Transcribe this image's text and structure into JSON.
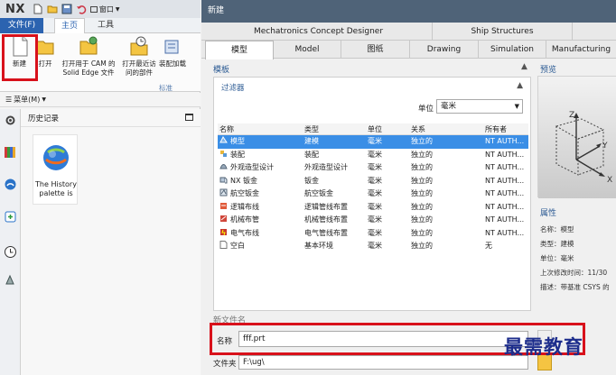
{
  "nx": {
    "logo": "NX",
    "tabs": {
      "file": "文件(F)",
      "home": "主页",
      "tools": "工具"
    },
    "ribbon": {
      "new": "新建",
      "open": "打开",
      "open_cam_1": "打开用于 CAM 的",
      "open_cam_2": "Solid Edge 文件",
      "open_recent_1": "打开最近访",
      "open_recent_2": "问的部件",
      "assembly": "装配加载",
      "group_label": "标准"
    },
    "quick_access": {
      "window_menu": "窗口"
    },
    "menu_bar": {
      "menu_label": "菜单(M)"
    },
    "history": {
      "title": "历史记录",
      "card_text_1": "The History",
      "card_text_2": "palette is"
    }
  },
  "dialog": {
    "title": "新建",
    "tabs_row1": [
      "Mechatronics Concept Designer",
      "Ship Structures"
    ],
    "tabs_row2": [
      "模型",
      "Model",
      "图纸",
      "Drawing",
      "Simulation",
      "Manufacturing"
    ],
    "templates_label": "模板",
    "filter_label": "过滤器",
    "unit_label": "单位",
    "unit_value": "毫米",
    "columns": [
      "名称",
      "类型",
      "单位",
      "关系",
      "所有者"
    ],
    "rows": [
      {
        "name": "模型",
        "type": "建模",
        "unit": "毫米",
        "relation": "独立的",
        "owner": "NT AUTH..."
      },
      {
        "name": "装配",
        "type": "装配",
        "unit": "毫米",
        "relation": "独立的",
        "owner": "NT AUTH..."
      },
      {
        "name": "外观造型设计",
        "type": "外观造型设计",
        "unit": "毫米",
        "relation": "独立的",
        "owner": "NT AUTH..."
      },
      {
        "name": "NX 钣金",
        "type": "钣金",
        "unit": "毫米",
        "relation": "独立的",
        "owner": "NT AUTH..."
      },
      {
        "name": "航空钣金",
        "type": "航空钣金",
        "unit": "毫米",
        "relation": "独立的",
        "owner": "NT AUTH..."
      },
      {
        "name": "逻辑布线",
        "type": "逻辑管线布置",
        "unit": "毫米",
        "relation": "独立的",
        "owner": "NT AUTH..."
      },
      {
        "name": "机械布管",
        "type": "机械管线布置",
        "unit": "毫米",
        "relation": "独立的",
        "owner": "NT AUTH..."
      },
      {
        "name": "电气布线",
        "type": "电气管线布置",
        "unit": "毫米",
        "relation": "独立的",
        "owner": "NT AUTH..."
      },
      {
        "name": "空白",
        "type": "基本环境",
        "unit": "毫米",
        "relation": "独立的",
        "owner": "无"
      }
    ],
    "preview_label": "预览",
    "axes": {
      "x": "X",
      "y": "Y",
      "z": "Z"
    },
    "properties_label": "属性",
    "properties": [
      {
        "label": "名称：",
        "value": "模型"
      },
      {
        "label": "类型：",
        "value": "建模"
      },
      {
        "label": "单位：",
        "value": "毫米"
      },
      {
        "label": "上次修改时间：",
        "value": "11/30"
      },
      {
        "label": "描述：",
        "value": "带基准 CSYS 的"
      }
    ],
    "new_file_label": "新文件名",
    "name_label": "名称",
    "name_value": "fff.prt",
    "folder_label": "文件夹",
    "folder_value": "F:\\ug\\"
  },
  "watermark": "最需教育",
  "colors": {
    "accent": "#2b63b0",
    "selection": "#3a8ee6",
    "highlight": "#d8111b",
    "dialog_title_bg": "#4f6378"
  }
}
